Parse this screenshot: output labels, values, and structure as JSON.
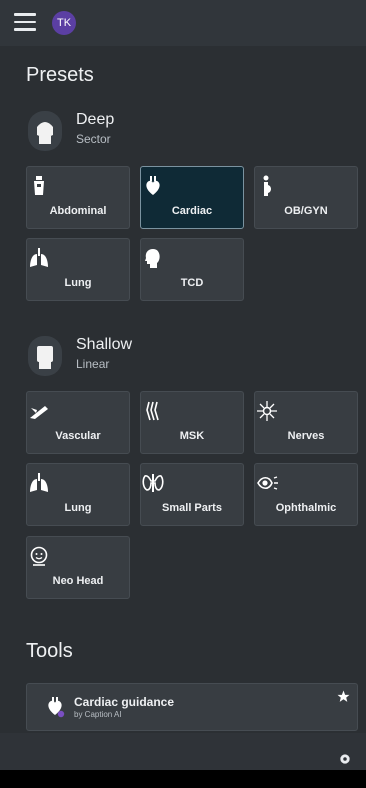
{
  "header": {
    "avatar_initials": "TK"
  },
  "presets": {
    "title": "Presets",
    "deep": {
      "name": "Deep",
      "type": "Sector",
      "tiles": [
        {
          "label": "Abdominal",
          "icon": "abdominal-icon",
          "selected": false
        },
        {
          "label": "Cardiac",
          "icon": "heart-icon",
          "selected": true
        },
        {
          "label": "OB/GYN",
          "icon": "pregnancy-icon",
          "selected": false
        },
        {
          "label": "Lung",
          "icon": "lungs-icon",
          "selected": false
        },
        {
          "label": "TCD",
          "icon": "head-icon",
          "selected": false
        }
      ]
    },
    "shallow": {
      "name": "Shallow",
      "type": "Linear",
      "tiles": [
        {
          "label": "Vascular",
          "icon": "vessel-icon",
          "selected": false
        },
        {
          "label": "MSK",
          "icon": "knee-icon",
          "selected": false
        },
        {
          "label": "Nerves",
          "icon": "nerve-icon",
          "selected": false
        },
        {
          "label": "Lung",
          "icon": "lungs-icon",
          "selected": false
        },
        {
          "label": "Small Parts",
          "icon": "thyroid-icon",
          "selected": false
        },
        {
          "label": "Ophthalmic",
          "icon": "eye-icon",
          "selected": false
        },
        {
          "label": "Neo Head",
          "icon": "baby-face-icon",
          "selected": false
        }
      ]
    }
  },
  "tools": {
    "title": "Tools",
    "items": [
      {
        "name": "Cardiac guidance",
        "provider": "by Caption AI",
        "favorite": true
      }
    ]
  },
  "colors": {
    "background": "#2b2f33",
    "tile": "#383d42",
    "selected_tile": "#0f2a36",
    "avatar": "#5b3fa3"
  }
}
